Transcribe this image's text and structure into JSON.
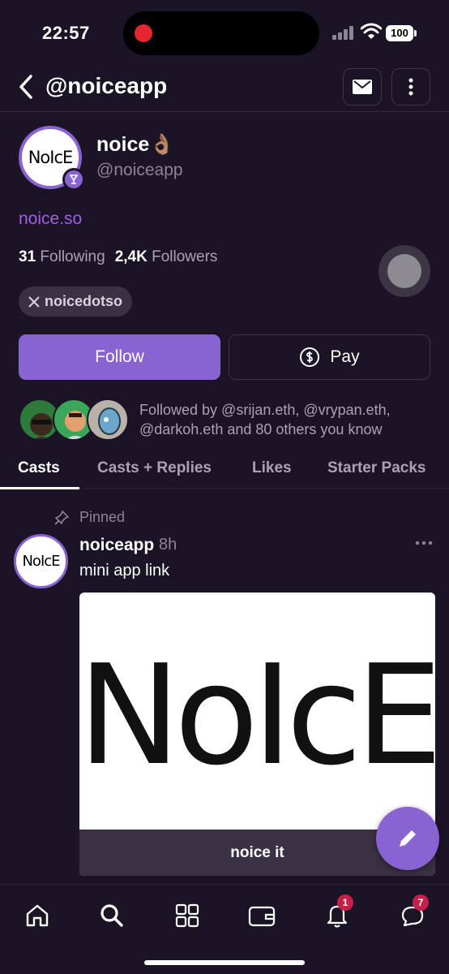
{
  "status_bar": {
    "time": "22:57",
    "battery": "100"
  },
  "header": {
    "title": "@noiceapp"
  },
  "profile": {
    "avatar_text": "NoIcE",
    "display_name": "noice👌🏽",
    "username": "@noiceapp",
    "website": "noice.so",
    "following_count": "31",
    "following_label": "Following",
    "followers_count": "2,4K",
    "followers_label": "Followers",
    "x_handle": "noicedotso"
  },
  "actions": {
    "follow_label": "Follow",
    "pay_label": "Pay"
  },
  "followed_by": {
    "text": "Followed by @srijan.eth, @vrypan.eth, @darkoh.eth and 80 others you know"
  },
  "tabs": [
    {
      "label": "Casts",
      "active": true
    },
    {
      "label": "Casts + Replies",
      "active": false
    },
    {
      "label": "Likes",
      "active": false
    },
    {
      "label": "Starter Packs",
      "active": false
    }
  ],
  "post": {
    "pinned_label": "Pinned",
    "author": "noiceapp",
    "time": "8h",
    "text": "mini app link",
    "embed_image_text": "NoIcE",
    "embed_button": "noice it"
  },
  "bottom_nav": {
    "items": [
      {
        "icon": "home-icon"
      },
      {
        "icon": "search-icon"
      },
      {
        "icon": "grid-icon"
      },
      {
        "icon": "wallet-icon"
      },
      {
        "icon": "bell-icon",
        "badge": "1"
      },
      {
        "icon": "chat-icon",
        "badge": "7"
      }
    ]
  },
  "colors": {
    "background": "#1b1426",
    "accent": "#8a63d2",
    "link": "#a05ee6",
    "badge": "#c71f4a"
  }
}
